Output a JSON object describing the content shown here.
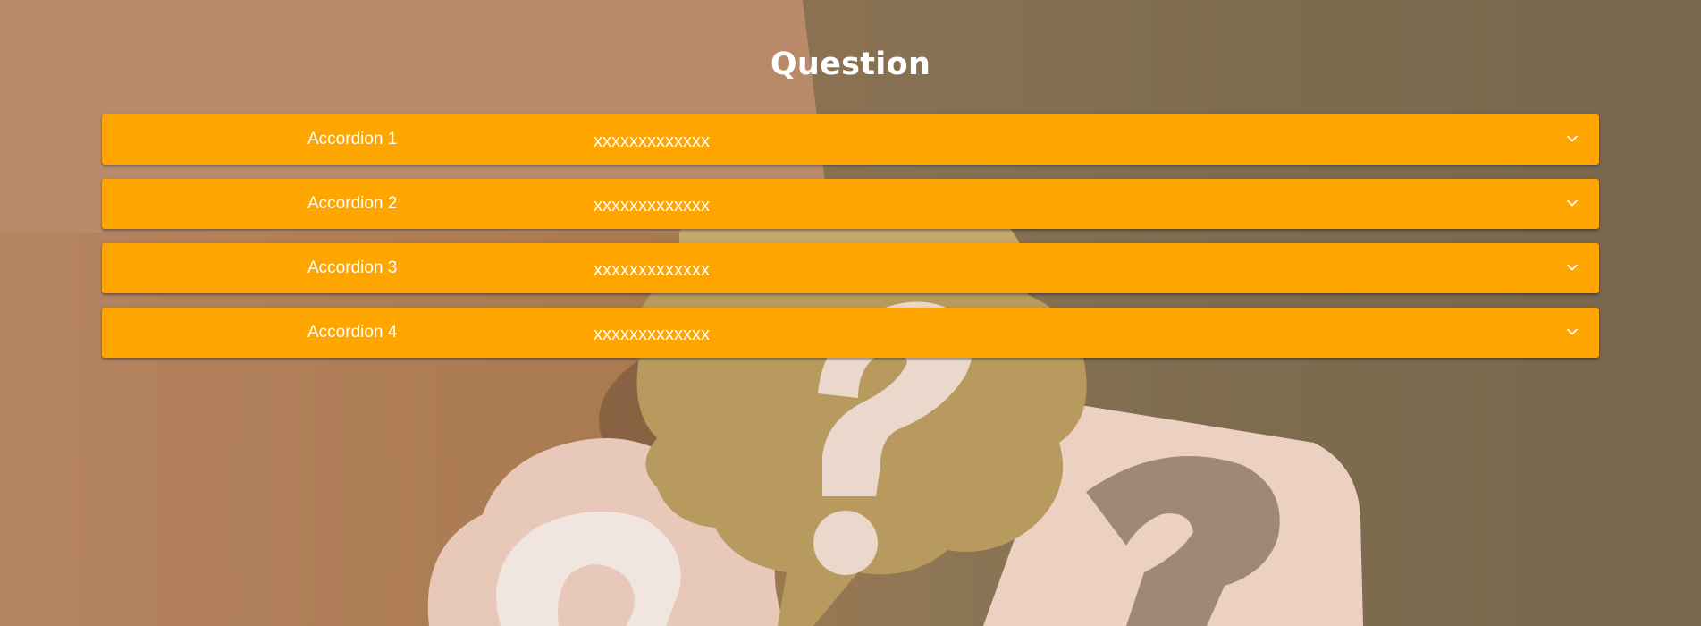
{
  "page": {
    "title": "Question"
  },
  "accordions": [
    {
      "title": "Accordion 1",
      "summary": "xxxxxxxxxxxxx",
      "icon": "chevron-down-icon"
    },
    {
      "title": "Accordion 2",
      "summary": "xxxxxxxxxxxxx",
      "icon": "chevron-down-icon"
    },
    {
      "title": "Accordion 3",
      "summary": "xxxxxxxxxxxxx",
      "icon": "chevron-down-icon"
    },
    {
      "title": "Accordion 4",
      "summary": "xxxxxxxxxxxxx",
      "icon": "chevron-down-icon"
    }
  ],
  "colors": {
    "accordion_bg": "#ffa500",
    "text": "#ffffff"
  }
}
